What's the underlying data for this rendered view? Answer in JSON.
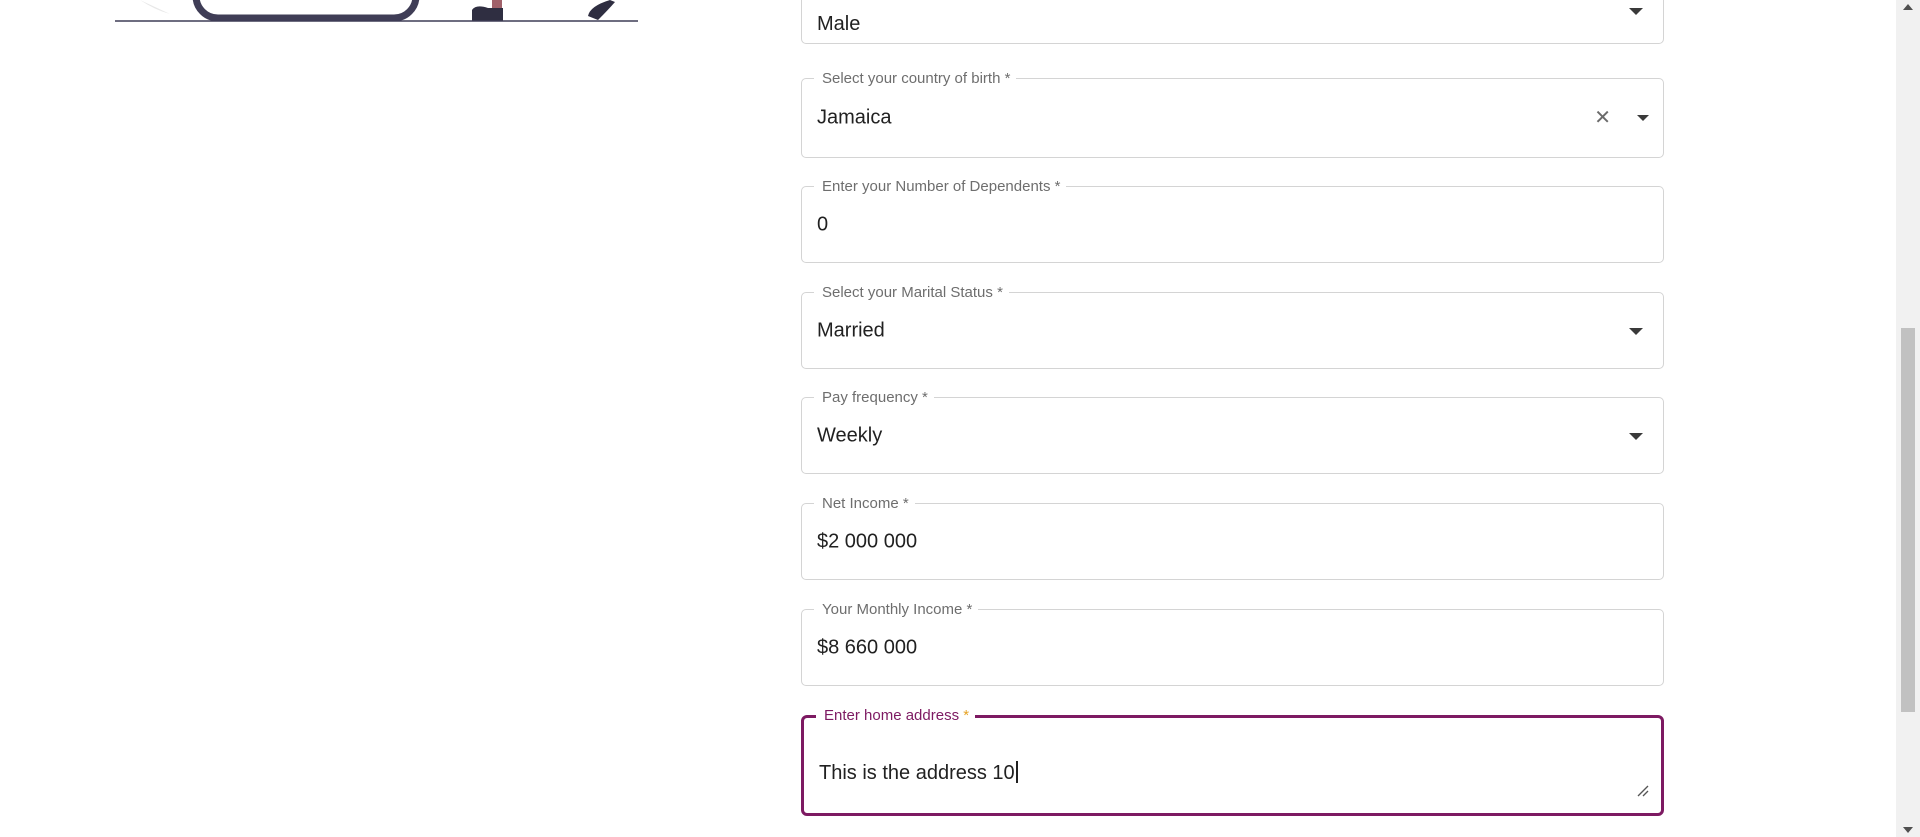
{
  "form": {
    "gender": {
      "value": "Male"
    },
    "country_of_birth": {
      "label": "Select your country of birth *",
      "value": "Jamaica",
      "clear_icon": "close-icon"
    },
    "dependents": {
      "label": "Enter your Number of Dependents *",
      "value": "0"
    },
    "marital_status": {
      "label": "Select your Marital Status *",
      "value": "Married"
    },
    "pay_frequency": {
      "label": "Pay frequency *",
      "value": "Weekly"
    },
    "net_income": {
      "label": "Net Income *",
      "value": "$2 000 000"
    },
    "monthly_income": {
      "label": "Your Monthly Income *",
      "value": "$8 660 000"
    },
    "home_address": {
      "label": "Enter home address",
      "required_mark": "*",
      "value": "This is the address 10"
    }
  },
  "colors": {
    "accent": "#7d1a62",
    "required": "#e6a224",
    "border": "#d4d4d4"
  }
}
